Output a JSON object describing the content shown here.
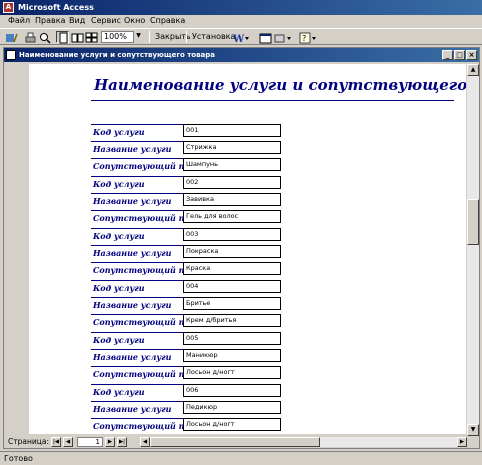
{
  "app": {
    "title": "Microsoft Access"
  },
  "menu": [
    "Файл",
    "Правка",
    "Вид",
    "Сервис",
    "Окно",
    "Справка"
  ],
  "toolbar": {
    "zoom": "100%",
    "close_label": "Закрыть",
    "setup_label": "Установка"
  },
  "window": {
    "title": "Наименование услуги и сопутствующего товара"
  },
  "report": {
    "title": "Наименование услуги и сопутствующего товара",
    "labels": {
      "code": "Код услуги",
      "name": "Название услуги",
      "product": "Сопутствующий то"
    },
    "records": [
      {
        "code": "001",
        "name": "Стрижка",
        "product": "Шампунь"
      },
      {
        "code": "002",
        "name": "Завивка",
        "product": "Гель для волос"
      },
      {
        "code": "003",
        "name": "Покраска",
        "product": "Краска"
      },
      {
        "code": "004",
        "name": "Бритье",
        "product": "Крем д/бритья"
      },
      {
        "code": "005",
        "name": "Маникюр",
        "product": "Лосьон д/ногт"
      },
      {
        "code": "006",
        "name": "Педикюр",
        "product": "Лосьон д/ногт"
      }
    ]
  },
  "nav": {
    "page_label": "Страница:",
    "page_number": "1"
  },
  "status": {
    "text": "Готово"
  },
  "colors": {
    "titlebar": "#0a246a",
    "report_text": "#000080"
  }
}
